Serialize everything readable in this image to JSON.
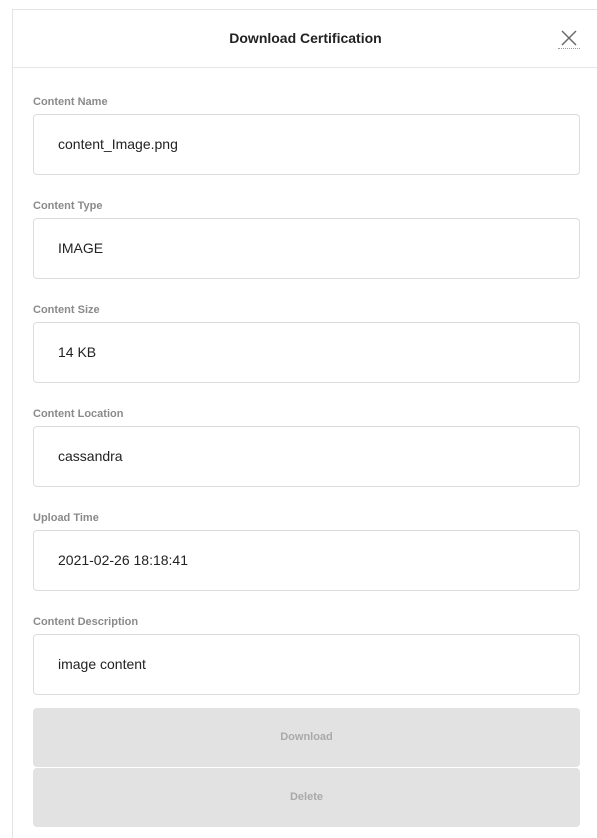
{
  "modal": {
    "title": "Download Certification",
    "close_icon": "close-icon"
  },
  "fields": [
    {
      "label": "Content Name",
      "value": "content_Image.png"
    },
    {
      "label": "Content Type",
      "value": "IMAGE"
    },
    {
      "label": "Content Size",
      "value": "14 KB"
    },
    {
      "label": "Content Location",
      "value": "cassandra"
    },
    {
      "label": "Upload Time",
      "value": "2021-02-26 18:18:41"
    },
    {
      "label": "Content Description",
      "value": "image content"
    }
  ],
  "actions": {
    "download_label": "Download",
    "delete_label": "Delete"
  },
  "colors": {
    "disabled_button_bg": "#e2e2e2",
    "disabled_button_text": "#a9a9a9",
    "label_text": "#8a8a8a",
    "border": "#dcdcdc"
  }
}
